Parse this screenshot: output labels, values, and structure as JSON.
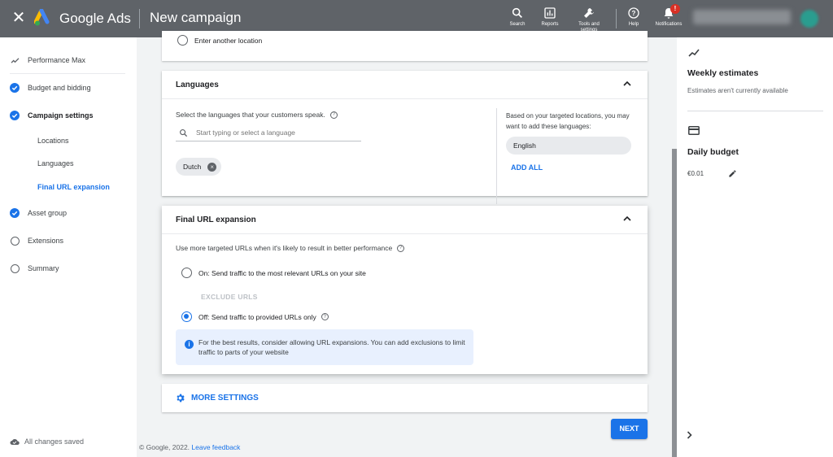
{
  "topbar": {
    "brand": "Google Ads",
    "page_title": "New campaign",
    "tools": [
      {
        "label": "Search",
        "icon": "search-icon"
      },
      {
        "label": "Reports",
        "icon": "reports-icon"
      },
      {
        "label": "Tools and settings",
        "icon": "wrench-icon"
      },
      {
        "label": "Help",
        "icon": "help-icon"
      },
      {
        "label": "Notifications",
        "icon": "bell-icon"
      }
    ],
    "notification_badge": "!"
  },
  "leftnav": {
    "items": [
      {
        "label": "Performance Max",
        "state": "header"
      },
      {
        "label": "Budget and bidding",
        "state": "done"
      },
      {
        "label": "Campaign settings",
        "state": "done"
      },
      {
        "label": "Asset group",
        "state": "done"
      },
      {
        "label": "Extensions",
        "state": "todo"
      },
      {
        "label": "Summary",
        "state": "todo"
      }
    ],
    "subitems": [
      "Locations",
      "Languages",
      "Final URL expansion"
    ],
    "saved_status": "All changes saved"
  },
  "locations": {
    "option_label": "Enter another location"
  },
  "languages": {
    "title": "Languages",
    "question": "Select the languages that your customers speak.",
    "search_placeholder": "Start typing or select a language",
    "selected": [
      "Dutch"
    ],
    "suggest_text": "Based on your targeted locations, you may want to add these languages:",
    "suggested": [
      "English"
    ],
    "add_all": "ADD ALL"
  },
  "final_url_expansion": {
    "title": "Final URL expansion",
    "description": "Use more targeted URLs when it's likely to result in better performance",
    "option_on": "On: Send traffic to the most relevant URLs on your site",
    "exclude_urls": "EXCLUDE URLS",
    "option_off": "Off: Send traffic to provided URLs only",
    "selected": "off",
    "info": "For the best results, consider allowing URL expansions. You can add exclusions to limit traffic to parts of your website"
  },
  "more_settings": "MORE SETTINGS",
  "next_button": "NEXT",
  "footer": {
    "copyright": "© Google, 2022.",
    "feedback": "Leave feedback"
  },
  "rightpanel": {
    "weekly_title": "Weekly estimates",
    "weekly_sub": "Estimates aren't currently available",
    "budget_title": "Daily budget",
    "budget_value": "€0.01"
  },
  "colors": {
    "topbar": "#5f6368",
    "accent": "#1a73e8",
    "info_bg": "#e8f0fe",
    "badge": "#d93025"
  }
}
